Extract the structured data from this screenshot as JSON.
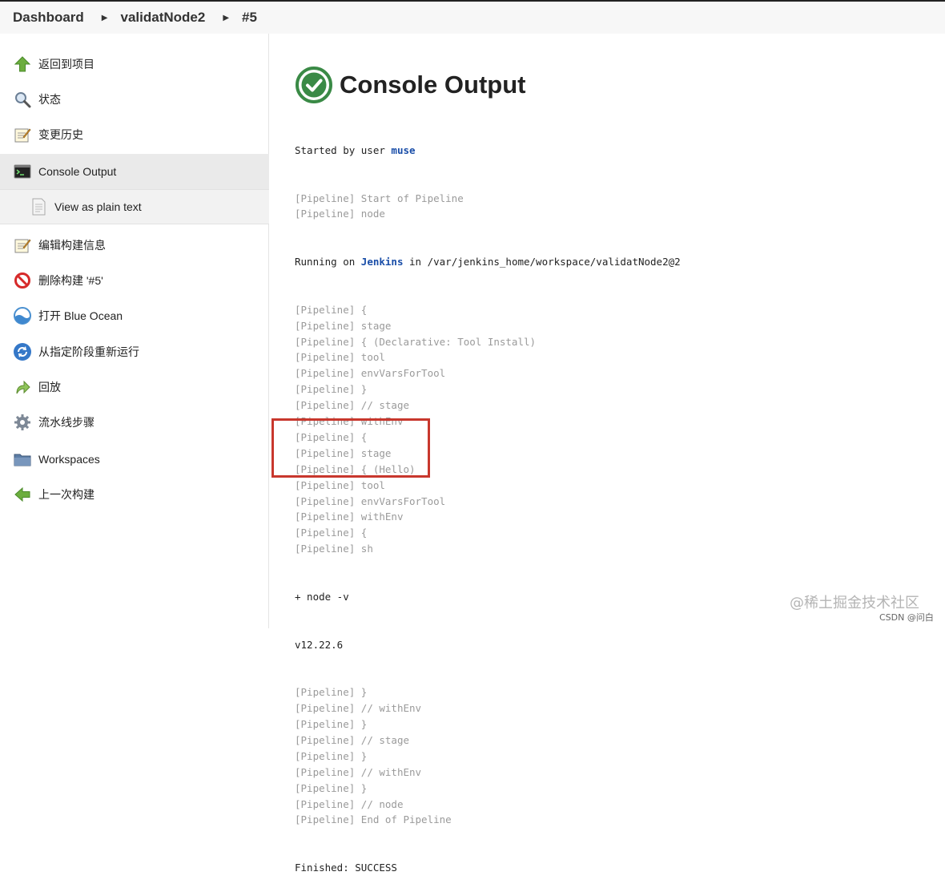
{
  "breadcrumb": {
    "items": [
      "Dashboard",
      "validatNode2",
      "#5"
    ]
  },
  "sidebar": {
    "items": [
      {
        "label": "返回到项目",
        "icon": "up-arrow-icon"
      },
      {
        "label": "状态",
        "icon": "magnifier-icon"
      },
      {
        "label": "变更历史",
        "icon": "notepad-icon"
      },
      {
        "label": "Console Output",
        "icon": "terminal-icon",
        "active": true
      },
      {
        "label": "View as plain text",
        "icon": "document-icon",
        "sub": true
      },
      {
        "label": "编辑构建信息",
        "icon": "notepad-icon"
      },
      {
        "label": "删除构建 '#5'",
        "icon": "no-entry-icon"
      },
      {
        "label": "打开 Blue Ocean",
        "icon": "blue-ocean-icon"
      },
      {
        "label": "从指定阶段重新运行",
        "icon": "refresh-icon"
      },
      {
        "label": "回放",
        "icon": "replay-arrow-icon"
      },
      {
        "label": "流水线步骤",
        "icon": "gear-icon"
      },
      {
        "label": "Workspaces",
        "icon": "folder-icon"
      },
      {
        "label": "上一次构建",
        "icon": "left-arrow-icon"
      }
    ]
  },
  "main": {
    "title": "Console Output",
    "status_color": "#3a8a46",
    "console": {
      "started_prefix": "Started by user ",
      "started_user": "muse",
      "running_prefix": "Running on ",
      "running_node": "Jenkins",
      "running_suffix": " in /var/jenkins_home/workspace/validatNode2@2",
      "pipeline_tag": "[Pipeline]",
      "lines_block1": [
        " Start of Pipeline",
        " node"
      ],
      "lines_block2": [
        " {",
        " stage",
        " { (Declarative: Tool Install)",
        " tool",
        " envVarsForTool",
        " }",
        " // stage",
        " withEnv",
        " {",
        " stage",
        " { (Hello)",
        " tool",
        " envVarsForTool",
        " withEnv",
        " {",
        " sh"
      ],
      "command": "+ node -v",
      "output": "v12.22.6",
      "lines_block3": [
        " }",
        " // withEnv",
        " }",
        " // stage",
        " }",
        " // withEnv",
        " }",
        " // node",
        " End of Pipeline"
      ],
      "finished": "Finished: SUCCESS"
    },
    "highlight_color": "#c8372d"
  },
  "watermark": {
    "text": "@稀土掘金技术社区",
    "credit": "CSDN @问白"
  }
}
